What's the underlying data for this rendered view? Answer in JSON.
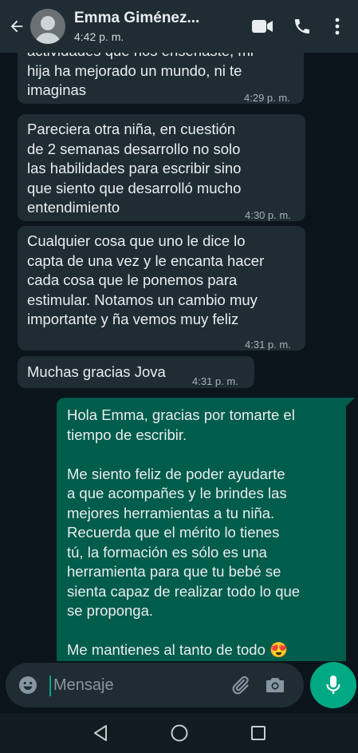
{
  "header": {
    "contact_name": "Emma Giménez...",
    "status": "4:42 p. m."
  },
  "messages": [
    {
      "direction": "in",
      "text": "actividades que nos enseñaste, mi\nhija ha mejorado un mundo, ni te\nimaginas",
      "time": "4:29 p. m."
    },
    {
      "direction": "in",
      "text": "Pareciera otra niña, en cuestión\nde 2 semanas desarrollo no solo\nlas habilidades para escribir sino\nque siento que desarrolló mucho\nentendimiento",
      "time": "4:30 p. m."
    },
    {
      "direction": "in",
      "text": "Cualquier cosa que uno le dice lo\ncapta de una vez y le encanta hacer\ncada cosa que le ponemos para\nestimular. Notamos un cambio muy\nimportante y ña vemos muy feliz",
      "time": "4:31 p. m."
    },
    {
      "direction": "in",
      "text": "Muchas gracias Jova",
      "time": "4:31 p. m."
    },
    {
      "direction": "out",
      "text": "Hola Emma, gracias por tomarte el\ntiempo de escribir.\n\nMe siento feliz de poder ayudarte\na que acompañes y le brindes las\nmejores herramientas a tu niña.\nRecuerda que el mérito lo tienes\ntú, la formación es sólo es una\nherramienta para que tu bebé se\nsienta capaz de realizar todo lo que\nse proponga.\n\nMe mantienes al tanto de todo",
      "emoji": "😍"
    }
  ],
  "composer": {
    "placeholder": "Mensaje"
  },
  "icons": {
    "back": "arrow-left-icon",
    "video": "video-camera-icon",
    "call": "phone-icon",
    "menu": "more-vertical-icon",
    "emoji": "emoji-icon",
    "attach": "paperclip-icon",
    "camera": "camera-icon",
    "mic": "microphone-icon",
    "nav_back": "triangle-back-icon",
    "nav_home": "circle-home-icon",
    "nav_recents": "square-recents-icon"
  },
  "colors": {
    "header_bg": "#1f2c34",
    "chat_bg": "#0b141a",
    "incoming_bubble": "#1f2c34",
    "outgoing_bubble": "#005c4b",
    "accent": "#00a884"
  }
}
